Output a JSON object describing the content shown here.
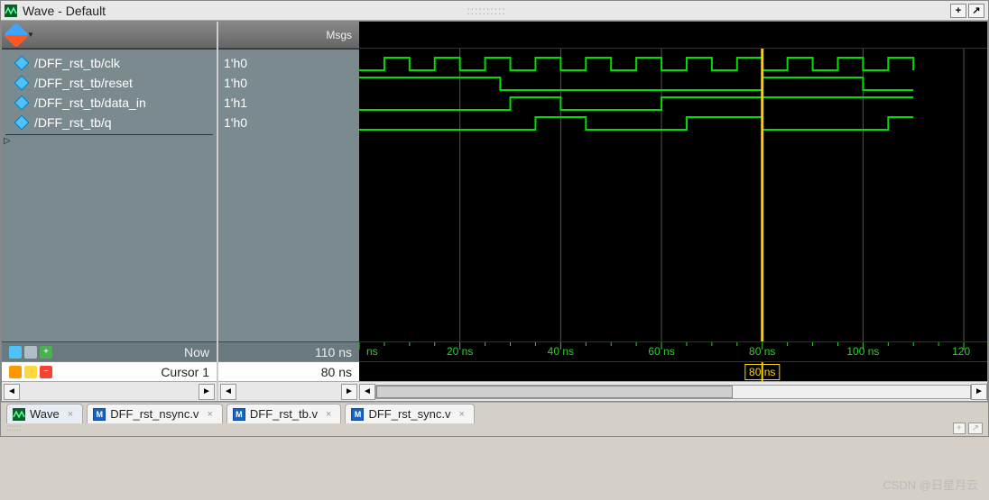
{
  "window": {
    "title": "Wave - Default",
    "buttons": {
      "add": "+",
      "dock": "↗"
    }
  },
  "columns": {
    "msgs_header": "Msgs"
  },
  "signals": [
    {
      "name": "/DFF_rst_tb/clk",
      "value": "1'h0"
    },
    {
      "name": "/DFF_rst_tb/reset",
      "value": "1'h0"
    },
    {
      "name": "/DFF_rst_tb/data_in",
      "value": "1'h1"
    },
    {
      "name": "/DFF_rst_tb/q",
      "value": "1'h0"
    }
  ],
  "summary": {
    "now_label": "Now",
    "now_value": "110 ns",
    "cursor_label": "Cursor 1",
    "cursor_value": "80 ns"
  },
  "ruler": {
    "start_label": "ns",
    "ticks": [
      "20 ns",
      "40 ns",
      "60 ns",
      "80 ns",
      "100 ns",
      "120 ns"
    ]
  },
  "cursor_strip": {
    "label": "80 ns"
  },
  "tabs": [
    {
      "kind": "wave",
      "label": "Wave",
      "active": true
    },
    {
      "kind": "file",
      "label": "DFF_rst_nsync.v"
    },
    {
      "kind": "file",
      "label": "DFF_rst_tb.v"
    },
    {
      "kind": "file",
      "label": "DFF_rst_sync.v"
    }
  ],
  "watermark": "CSDN @日星月云",
  "bottom_dock": {
    "add": "+",
    "dock": "↗"
  },
  "chart_data": {
    "type": "waveform",
    "x_unit": "ns",
    "x_range": [
      0,
      125
    ],
    "cursor_time": 80,
    "now_time": 110,
    "grid_major": [
      20,
      40,
      60,
      80,
      100,
      120
    ],
    "signals": [
      {
        "name": "clk",
        "bits": 1,
        "values": [
          {
            "t": 0,
            "v": 0
          },
          {
            "t": 5,
            "v": 1
          },
          {
            "t": 10,
            "v": 0
          },
          {
            "t": 15,
            "v": 1
          },
          {
            "t": 20,
            "v": 0
          },
          {
            "t": 25,
            "v": 1
          },
          {
            "t": 30,
            "v": 0
          },
          {
            "t": 35,
            "v": 1
          },
          {
            "t": 40,
            "v": 0
          },
          {
            "t": 45,
            "v": 1
          },
          {
            "t": 50,
            "v": 0
          },
          {
            "t": 55,
            "v": 1
          },
          {
            "t": 60,
            "v": 0
          },
          {
            "t": 65,
            "v": 1
          },
          {
            "t": 70,
            "v": 0
          },
          {
            "t": 75,
            "v": 1
          },
          {
            "t": 80,
            "v": 0
          },
          {
            "t": 85,
            "v": 1
          },
          {
            "t": 90,
            "v": 0
          },
          {
            "t": 95,
            "v": 1
          },
          {
            "t": 100,
            "v": 0
          },
          {
            "t": 105,
            "v": 1
          },
          {
            "t": 110,
            "v": 0
          }
        ]
      },
      {
        "name": "reset",
        "bits": 1,
        "values": [
          {
            "t": 0,
            "v": 1
          },
          {
            "t": 28,
            "v": 0
          },
          {
            "t": 80,
            "v": 1
          },
          {
            "t": 100,
            "v": 0
          }
        ]
      },
      {
        "name": "data_in",
        "bits": 1,
        "values": [
          {
            "t": 0,
            "v": 0
          },
          {
            "t": 30,
            "v": 1
          },
          {
            "t": 40,
            "v": 0
          },
          {
            "t": 60,
            "v": 1
          }
        ]
      },
      {
        "name": "q",
        "bits": 1,
        "values": [
          {
            "t": 0,
            "v": 0
          },
          {
            "t": 35,
            "v": 1
          },
          {
            "t": 45,
            "v": 0
          },
          {
            "t": 65,
            "v": 1
          },
          {
            "t": 80,
            "v": 0
          },
          {
            "t": 105,
            "v": 1
          }
        ]
      }
    ]
  }
}
